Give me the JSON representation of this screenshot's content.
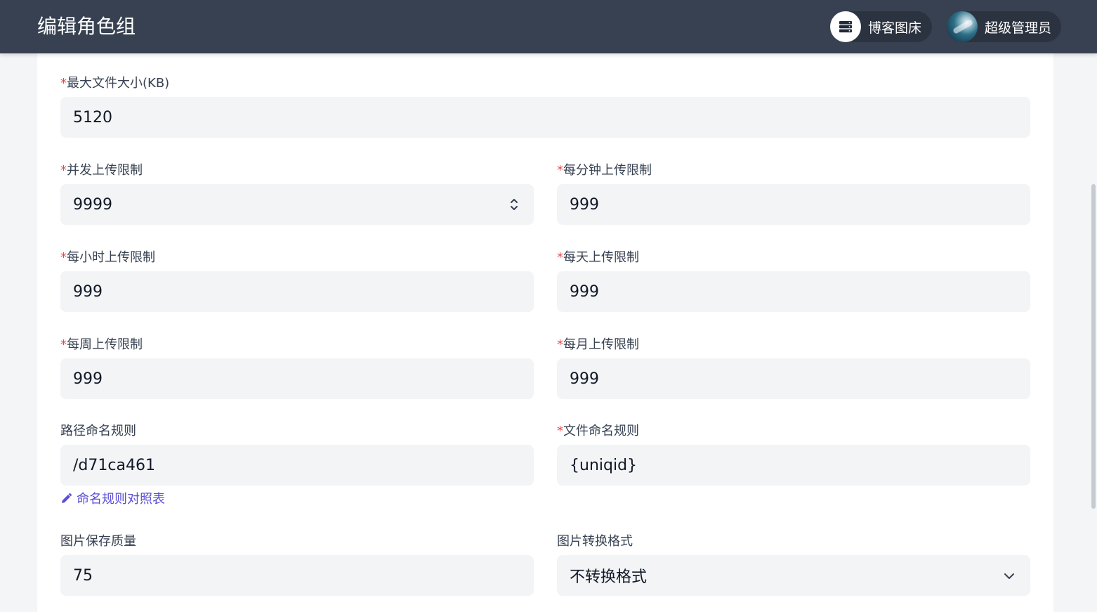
{
  "header": {
    "title": "编辑角色组",
    "blog_pill": {
      "icon": "server-icon",
      "label": "博客图床"
    },
    "user_pill": {
      "label": "超级管理员"
    }
  },
  "form": {
    "max_file_size": {
      "required": true,
      "label": "最大文件大小(KB)",
      "value": "5120"
    },
    "concurrent_limit": {
      "required": true,
      "label": "并发上传限制",
      "value": "9999"
    },
    "per_minute_limit": {
      "required": true,
      "label": "每分钟上传限制",
      "value": "999"
    },
    "per_hour_limit": {
      "required": true,
      "label": "每小时上传限制",
      "value": "999"
    },
    "per_day_limit": {
      "required": true,
      "label": "每天上传限制",
      "value": "999"
    },
    "per_week_limit": {
      "required": true,
      "label": "每周上传限制",
      "value": "999"
    },
    "per_month_limit": {
      "required": true,
      "label": "每月上传限制",
      "value": "999"
    },
    "path_rule": {
      "required": false,
      "label": "路径命名规则",
      "value": "/d71ca461"
    },
    "file_rule": {
      "required": true,
      "label": "文件命名规则",
      "value": "{uniqid}"
    },
    "naming_link": {
      "icon": "pencil-icon",
      "label": "命名规则对照表"
    },
    "image_quality": {
      "required": false,
      "label": "图片保存质量",
      "value": "75"
    },
    "image_format": {
      "required": false,
      "label": "图片转换格式",
      "value": "不转换格式"
    }
  },
  "required_mark": "*",
  "colors": {
    "header_bg": "#374151",
    "input_bg": "#f3f4f6",
    "required": "#ef4444",
    "link": "#5b4fd6"
  }
}
